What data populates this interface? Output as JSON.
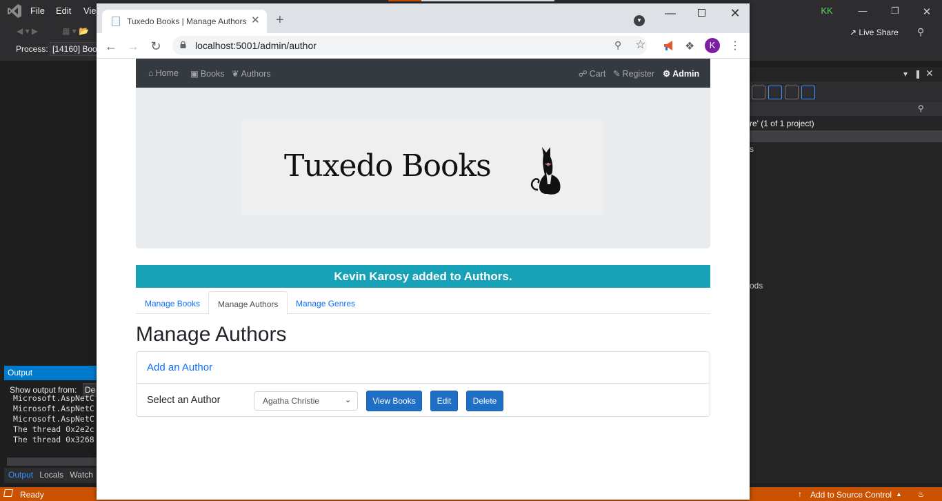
{
  "vs": {
    "menu": [
      "File",
      "Edit",
      "Vie"
    ],
    "avatar_initials": "KK",
    "live_share": "Live Share",
    "process_label": "Process:",
    "process_value": "[14160] Boo",
    "solution_text": "re' (1 of 1 project)",
    "solution_s": "s",
    "solution_ods": "ods",
    "output_title": "Output",
    "output_from_label": "Show output from:",
    "output_from_value": "De",
    "output_lines": [
      "Microsoft.AspNetC",
      "Microsoft.AspNetC",
      "Microsoft.AspNetC",
      "The thread 0x2e2c",
      "The thread 0x3268"
    ],
    "output_tabs": [
      "Output",
      "Locals",
      "Watch"
    ],
    "status_ready": "Ready",
    "status_source": "Add to Source Control",
    "accent_color": "#ca5100"
  },
  "browser": {
    "tab_title": "Tuxedo Books | Manage Authors",
    "url": "localhost:5001/admin/author",
    "profile_initial": "K",
    "profile_color": "#7b1fa2"
  },
  "site": {
    "nav_left": [
      {
        "label": "Home",
        "icon": "home-icon"
      },
      {
        "label": "Books",
        "icon": "book-icon"
      },
      {
        "label": "Authors",
        "icon": "feather-icon"
      }
    ],
    "nav_right": [
      {
        "label": "Cart",
        "icon": "cart-icon"
      },
      {
        "label": "Register",
        "icon": "edit-icon"
      },
      {
        "label": "Admin",
        "icon": "gear-icon"
      }
    ],
    "logo_text": "Tuxedo Books",
    "alert": "Kevin Karosy added to Authors.",
    "alert_color": "#17a2b8",
    "tabs": [
      {
        "label": "Manage Books",
        "active": false
      },
      {
        "label": "Manage Authors",
        "active": true
      },
      {
        "label": "Manage Genres",
        "active": false
      }
    ],
    "page_title": "Manage Authors",
    "add_author": "Add an Author",
    "select_label": "Select an Author",
    "selected_author": "Agatha Christie",
    "buttons": {
      "view": "View Books",
      "edit": "Edit",
      "delete": "Delete"
    },
    "button_color": "#1f6fc5"
  }
}
